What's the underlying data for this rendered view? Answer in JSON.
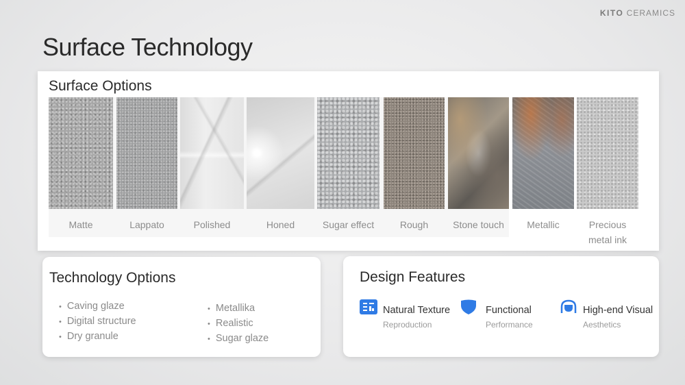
{
  "brand": {
    "bold": "KITO",
    "rest": "CERAMICS"
  },
  "page_title": "Surface Technology",
  "surface": {
    "title": "Surface Options",
    "tiles": [
      {
        "label": "Matte"
      },
      {
        "label": "Lappato"
      },
      {
        "label": "Polished"
      },
      {
        "label": "Honed"
      },
      {
        "label": "Sugar effect"
      },
      {
        "label": "Rough"
      },
      {
        "label": "Stone touch"
      },
      {
        "label": "Metallic"
      },
      {
        "label": "Precious metal ink"
      }
    ]
  },
  "technology": {
    "title": "Technology  Options",
    "left_items": [
      "Caving glaze",
      "Digital structure",
      "Dry granule"
    ],
    "right_items": [
      "Metallika",
      "Realistic",
      "Sugar glaze"
    ]
  },
  "design": {
    "title": "Design Features",
    "features": [
      {
        "title": "Natural Texture",
        "subtitle": "Reproduction",
        "icon": "texture-grid-icon"
      },
      {
        "title": "Functional",
        "subtitle": "Performance",
        "icon": "shield-icon"
      },
      {
        "title": "High-end Visual",
        "subtitle": "Aesthetics",
        "icon": "gem-icon"
      }
    ]
  },
  "colors": {
    "accent": "#2f7be5",
    "text": "#2a2a2a",
    "muted": "#8a8a8a"
  }
}
